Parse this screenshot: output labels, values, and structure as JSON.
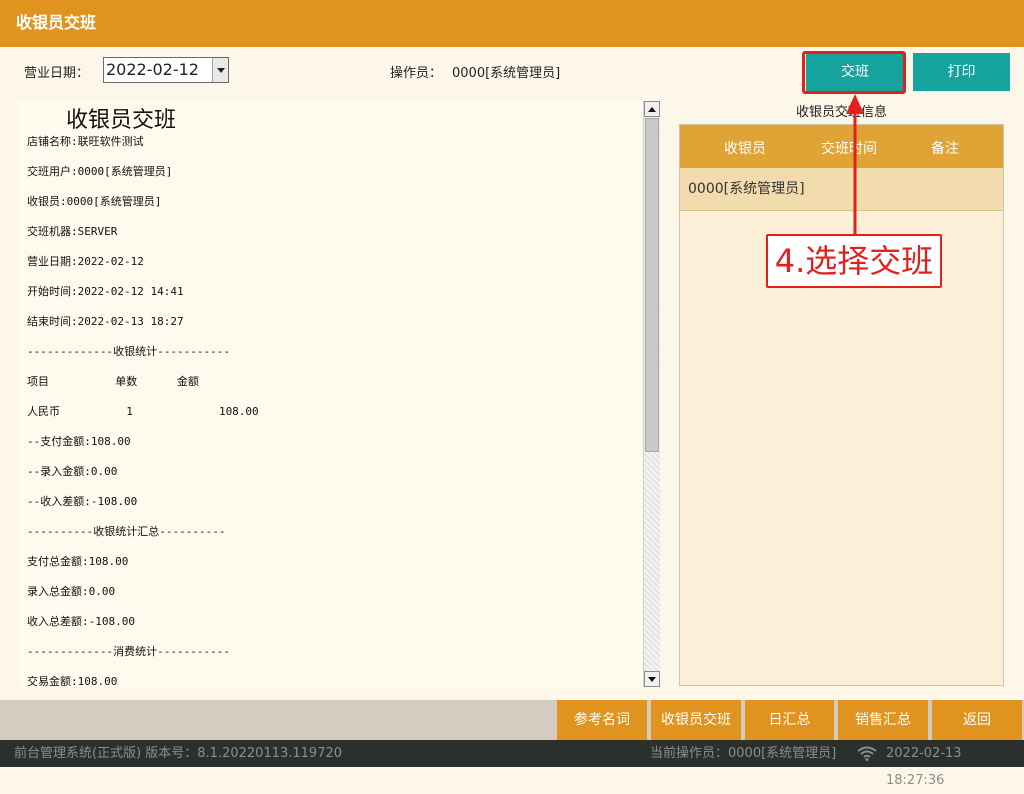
{
  "window": {
    "title": "收银员交班"
  },
  "toolbar": {
    "date_label": "营业日期：",
    "date_value": "2022-02-12",
    "operator_label": "操作员：",
    "operator_value": "0000[系统管理员]",
    "shift_button": "交班",
    "print_button": "打印"
  },
  "receipt": {
    "title": "收银员交班",
    "lines": [
      "店铺名称:联旺软件测试",
      "交班用户:0000[系统管理员]",
      "收银员:0000[系统管理员]",
      "交班机器:SERVER",
      "营业日期:2022-02-12",
      "开始时间:2022-02-12 14:41",
      "结束时间:2022-02-13 18:27",
      "-------------收银统计-----------",
      "项目          单数      金额",
      "人民币          1             108.00",
      "--支付金额:108.00",
      "--录入金额:0.00",
      "--收入差额:-108.00",
      "----------收银统计汇总----------",
      "支付总金额:108.00",
      "录入总金额:0.00",
      "收入总差额:-108.00",
      "-------------消费统计-----------",
      "交易金额:108.00"
    ]
  },
  "shift_info": {
    "title": "收银员交班信息",
    "columns": [
      "收银员",
      "交班时间",
      "备注"
    ],
    "rows": [
      {
        "cashier": "0000[系统管理员]",
        "time": "",
        "note": ""
      }
    ]
  },
  "annotation": {
    "text": "4.选择交班",
    "color": "#e2211d"
  },
  "bottom_nav": [
    "参考名词",
    "收银员交班",
    "日汇总",
    "销售汇总",
    "返回"
  ],
  "status": {
    "system": "前台管理系统(正式版) 版本号：8.1.20220113.119720",
    "current_operator": "当前操作员：0000[系统管理员]",
    "datetime": "2022-02-13 18:27:36"
  },
  "colors": {
    "accent": "#e0941f",
    "teal_button": "#16a29d",
    "table_header": "#dfa336",
    "status_bar": "#2b302c"
  }
}
